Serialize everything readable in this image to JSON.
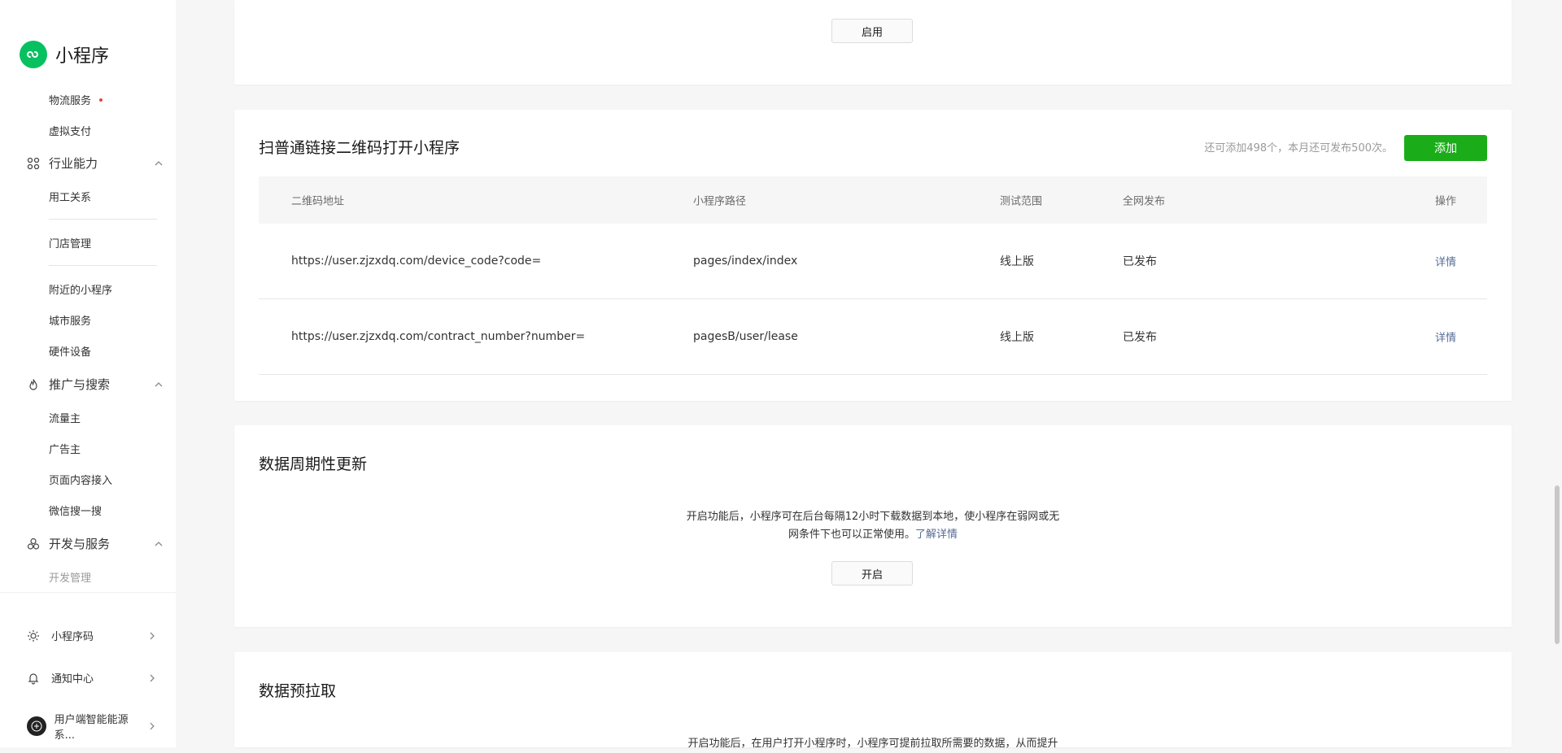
{
  "app": {
    "title": "小程序"
  },
  "sidebar": {
    "items_top": [
      {
        "label": "物流服务",
        "dot": true
      },
      {
        "label": "虚拟支付"
      }
    ],
    "group_industry": {
      "label": "行业能力"
    },
    "industry_items": [
      "用工关系",
      "门店管理",
      "附近的小程序",
      "城市服务",
      "硬件设备"
    ],
    "group_promo": {
      "label": "推广与搜索"
    },
    "promo_items": [
      "流量主",
      "广告主",
      "页面内容接入",
      "微信搜一搜"
    ],
    "group_dev": {
      "label": "开发与服务"
    },
    "dev_items": [
      "开发管理"
    ],
    "bottom": {
      "qrcode": "小程序码",
      "notify": "通知中心",
      "account": "用户端智能能源系..."
    }
  },
  "card_top": {
    "enable_button": "启用"
  },
  "qr_card": {
    "title": "扫普通链接二维码打开小程序",
    "quota_text": "还可添加498个，本月还可发布500次。",
    "add_button": "添加",
    "columns": [
      "二维码地址",
      "小程序路径",
      "测试范围",
      "全网发布",
      "操作"
    ],
    "rows": [
      {
        "url": "https://user.zjzxdq.com/device_code?code=",
        "path": "pages/index/index",
        "scope": "线上版",
        "status": "已发布",
        "action": "详情"
      },
      {
        "url": "https://user.zjzxdq.com/contract_number?number=",
        "path": "pagesB/user/lease",
        "scope": "线上版",
        "status": "已发布",
        "action": "详情"
      }
    ]
  },
  "periodic_card": {
    "title": "数据周期性更新",
    "desc_line1": "开启功能后，小程序可在后台每隔12小时下载数据到本地，使小程序在弱网或无",
    "desc_line2": "网条件下也可以正常使用。",
    "learn_more": "了解详情",
    "open_button": "开启"
  },
  "prefetch_card": {
    "title": "数据预拉取",
    "desc_line1": "开启功能后，在用户打开小程序时，小程序可提前拉取所需要的数据，从而提升"
  },
  "colors": {
    "primary": "#1aad19",
    "brand": "#07c160",
    "link": "#576b95",
    "dot": "#e64340"
  }
}
